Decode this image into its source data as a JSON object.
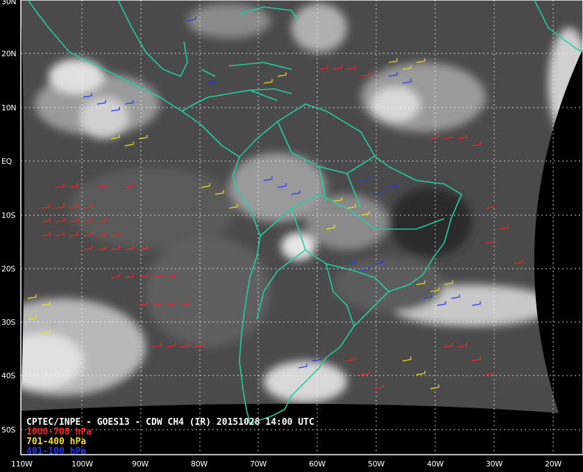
{
  "caption": {
    "title": "CPTEC/INPE - GOES13 - CDW CH4 (IR) 20151028 14:00 UTC",
    "legend": [
      {
        "label": "1000-700 hPa",
        "color": "#ff2020"
      },
      {
        "label": "701-400 hPa",
        "color": "#f0e020"
      },
      {
        "label": "401-100 hPa",
        "color": "#2233ff"
      }
    ]
  },
  "lat_labels": [
    "30N",
    "20N",
    "10N",
    "EQ",
    "10S",
    "20S",
    "30S",
    "40S",
    "50S"
  ],
  "lon_labels": [
    "110W",
    "100W",
    "90W",
    "80W",
    "70W",
    "60W",
    "50W",
    "40W",
    "30W",
    "20W"
  ],
  "colors": {
    "background": "#000000",
    "coastline": "#20d0a0",
    "grid": "#ffffff",
    "cloud_bright": "#e8e8e8",
    "scene_gray": "#505050"
  }
}
